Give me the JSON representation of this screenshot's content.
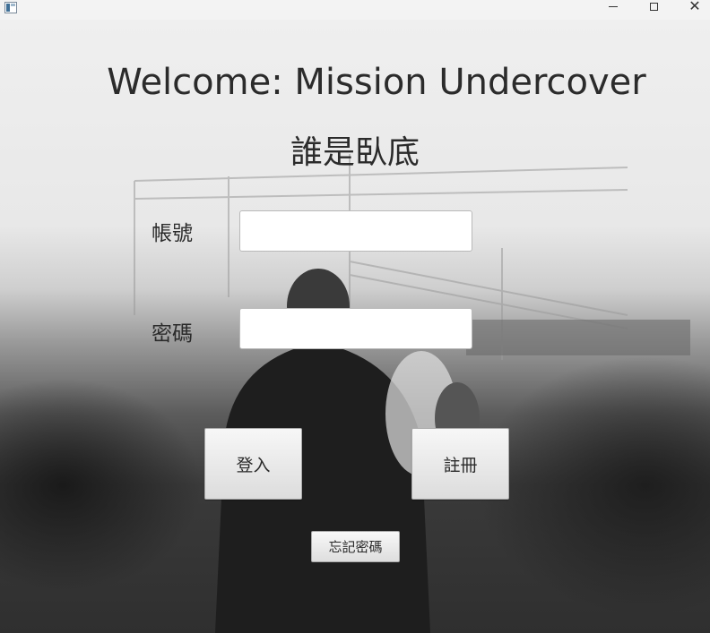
{
  "window": {
    "app_icon": "java-app-icon",
    "controls": {
      "minimize_icon": "minimize-icon",
      "maximize_icon": "maximize-icon",
      "close_icon": "close-icon",
      "close_glyph": "✕"
    }
  },
  "header": {
    "title": "Welcome: Mission Undercover",
    "subtitle": "誰是臥底"
  },
  "form": {
    "account": {
      "label": "帳號",
      "value": "",
      "placeholder": ""
    },
    "password": {
      "label": "密碼",
      "value": "",
      "placeholder": ""
    }
  },
  "actions": {
    "login_label": "登入",
    "register_label": "註冊",
    "forgot_label": "忘記密碼"
  },
  "colors": {
    "text": "#2b2b2b",
    "titlebar": "#f3f3f3",
    "button_top": "#f7f7f7",
    "button_bottom": "#dcdcdc"
  }
}
